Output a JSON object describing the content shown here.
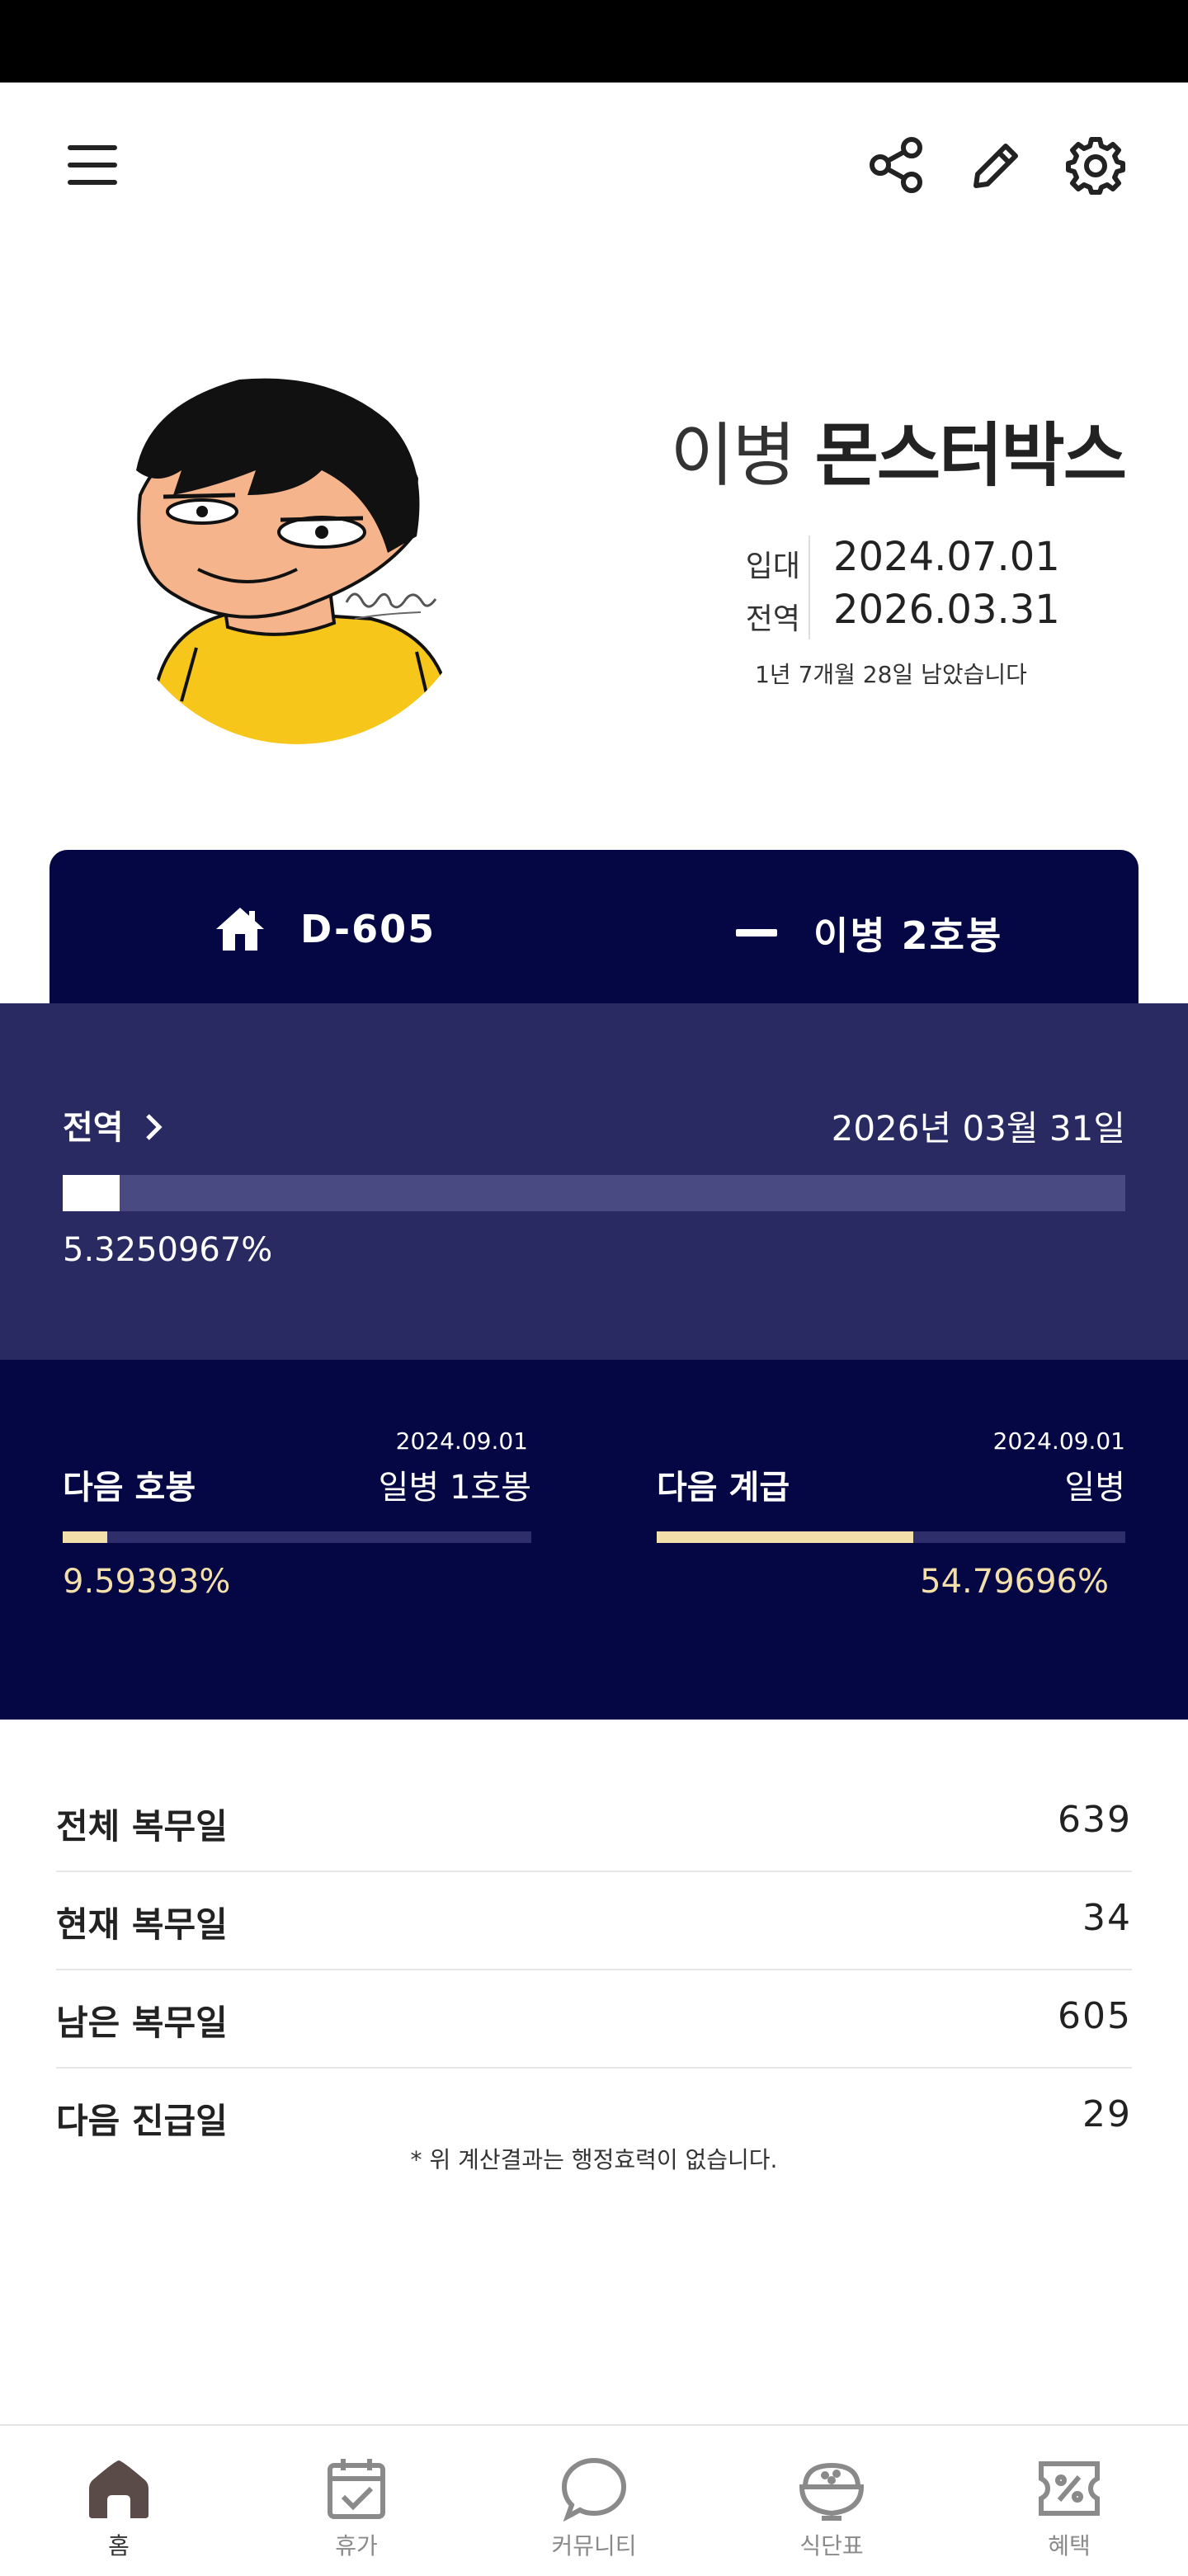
{
  "profile": {
    "rank": "이병",
    "name": "몬스터박스",
    "enlist_label": "입대",
    "enlist_date": "2024.07.01",
    "discharge_label": "전역",
    "discharge_date": "2026.03.31",
    "remaining_text": "1년 7개월 28일 남았습니다",
    "avatar_signature": "몬스터박스"
  },
  "tabs": {
    "dday": "D-605",
    "rank_grade": "이병 2호봉"
  },
  "discharge_progress": {
    "title": "전역",
    "date_text": "2026년 03월 31일",
    "percent_text": "5.3250967%",
    "percent": 5.3250967
  },
  "next_grade": {
    "title": "다음 호봉",
    "date": "2024.09.01",
    "target": "일병 1호봉",
    "percent_text": "9.59393%",
    "percent": 9.59393
  },
  "next_rank": {
    "title": "다음 계급",
    "date": "2024.09.01",
    "target": "일병",
    "percent_text": "54.79696%",
    "percent": 54.79696
  },
  "stats": [
    {
      "label": "전체 복무일",
      "value": "639"
    },
    {
      "label": "현재 복무일",
      "value": "34"
    },
    {
      "label": "남은 복무일",
      "value": "605"
    },
    {
      "label": "다음 진급일",
      "value": "29"
    }
  ],
  "disclaimer": "* 위 계산결과는 행정효력이 없습니다.",
  "nav": [
    {
      "label": "홈",
      "icon": "home-icon",
      "active": true
    },
    {
      "label": "휴가",
      "icon": "calendar-check-icon",
      "active": false
    },
    {
      "label": "커뮤니티",
      "icon": "chat-bubble-icon",
      "active": false
    },
    {
      "label": "식단표",
      "icon": "rice-bowl-icon",
      "active": false
    },
    {
      "label": "혜택",
      "icon": "coupon-icon",
      "active": false
    }
  ],
  "colors": {
    "navy": "#050644",
    "progress_bg": "#2a2a62",
    "accent": "#f2dfaa"
  }
}
